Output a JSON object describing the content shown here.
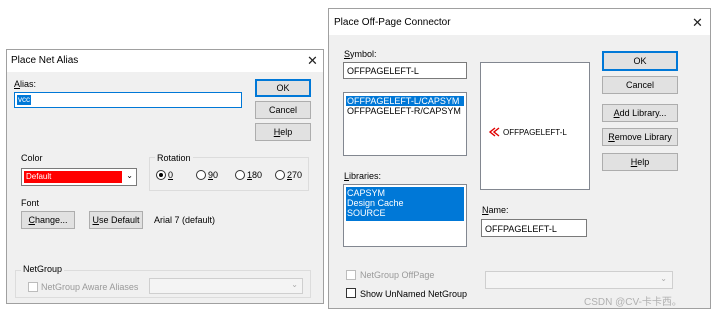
{
  "alias_dialog": {
    "title": "Place Net Alias",
    "close_glyph": "✕",
    "alias_label_hotkey": "A",
    "alias_label_rest": "lias:",
    "alias_value": "vcc",
    "ok": "OK",
    "cancel": "Cancel",
    "help_hotkey": "H",
    "help_rest": "elp",
    "color_label": "Color",
    "color_value": "Default",
    "color_swatch": "#ff0000",
    "rotation_label": "Rotation",
    "rotations": [
      {
        "hotkey": "0",
        "rest": ""
      },
      {
        "hotkey": "9",
        "rest": "0"
      },
      {
        "hotkey": "1",
        "rest": "80"
      },
      {
        "hotkey": "2",
        "rest": "70"
      }
    ],
    "font_label": "Font",
    "change_hotkey": "C",
    "change_rest": "hange...",
    "use_default_hotkey": "U",
    "use_default_rest": "se Default",
    "font_value": "Arial 7 (default)",
    "netgroup_label": "NetGroup",
    "netgroup_aware": "NetGroup Aware Aliases"
  },
  "connector_dialog": {
    "title": "Place Off-Page Connector",
    "close_glyph": "✕",
    "symbol_label_hotkey": "S",
    "symbol_label_rest": "ymbol:",
    "symbol_value": "OFFPAGELEFT-L",
    "symbols": [
      "OFFPAGELEFT-L/CAPSYM",
      "OFFPAGELEFT-R/CAPSYM"
    ],
    "libraries_label_hotkey": "L",
    "libraries_label_rest": "ibraries:",
    "libraries": [
      "CAPSYM",
      "Design Cache",
      "SOURCE"
    ],
    "preview_text": "OFFPAGELEFT-L",
    "ok": "OK",
    "cancel": "Cancel",
    "add_library_hotkey": "A",
    "add_library_rest": "dd Library...",
    "remove_library_hotkey": "R",
    "remove_library_rest": "emove Library",
    "help_hotkey": "H",
    "help_rest": "elp",
    "name_label_hotkey": "N",
    "name_label_rest": "ame:",
    "name_value": "OFFPAGELEFT-L",
    "netgroup_offpage": "NetGroup OffPage",
    "show_unnamed": "Show UnNamed NetGroup",
    "accent": "#0078d7"
  },
  "watermark": "CSDN @CV-卡卡西。"
}
